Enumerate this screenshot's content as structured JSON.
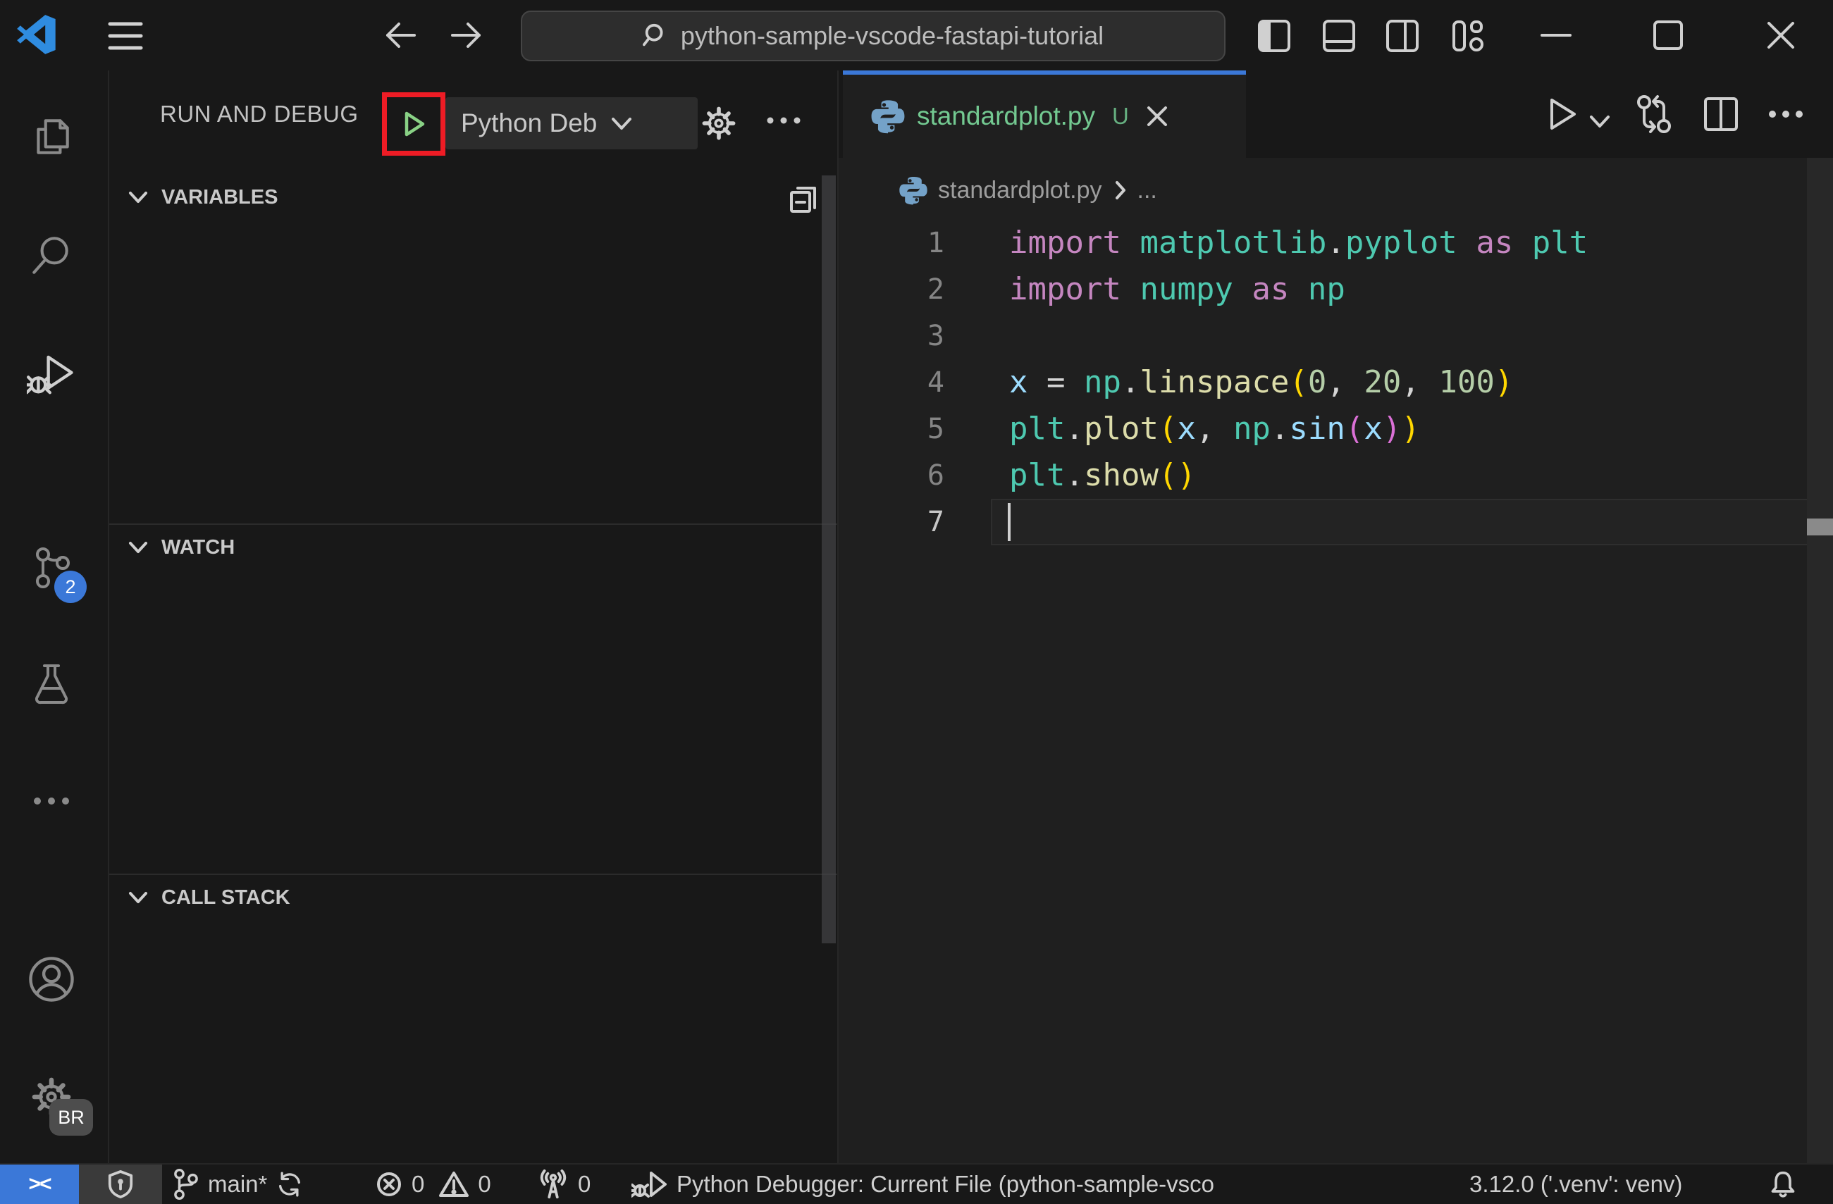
{
  "colors": {
    "accent": "#3b78d8",
    "highlight_red": "#ee1c25",
    "run_green": "#89d185",
    "untracked_green": "#73c991",
    "kw": "#C586C0",
    "mod": "#4EC9B0",
    "fn": "#DCDCAA",
    "var": "#9CDCFE",
    "num": "#B5CEA8",
    "pun": "#D4D4D4",
    "b1": "#FFD700",
    "b2": "#DA70D6",
    "gutter": "#858585"
  },
  "titlebar": {
    "search": "python-sample-vscode-fastapi-tutorial",
    "icons": [
      "vscode-logo",
      "menu-icon",
      "arrow-back-icon",
      "arrow-forward-icon",
      "search-icon",
      "layout-sidebar-icon",
      "layout-panel-icon",
      "layout-sidebar-right-icon",
      "layout-customize-icon",
      "minimize-icon",
      "maximize-icon",
      "close-icon"
    ]
  },
  "activitybar": {
    "items": [
      "explorer",
      "search",
      "run-and-debug",
      "source-control",
      "testing",
      "more",
      "account",
      "settings"
    ],
    "active_item": "run-and-debug",
    "source_control_badge": "2",
    "profile_badge": "BR"
  },
  "sidebar": {
    "title": "RUN AND DEBUG",
    "config_label": "Python Deb",
    "sections": [
      "VARIABLES",
      "WATCH",
      "CALL STACK"
    ],
    "icons": [
      "play-icon",
      "chevron-down-icon",
      "gear-icon",
      "ellipsis-icon",
      "collapse-all-icon"
    ]
  },
  "editor": {
    "tab_label": "standardplot.py",
    "tab_dirty": "U",
    "breadcrumb_file": "standardplot.py",
    "breadcrumb_more": "...",
    "toolbar_icons": [
      "run-icon",
      "chevron-down-icon",
      "compare-changes-icon",
      "split-editor-icon",
      "ellipsis-icon"
    ],
    "code_lines": [
      {
        "num": "1",
        "tokens": [
          {
            "c": "kw",
            "t": "import"
          },
          {
            "c": "pln",
            "t": " "
          },
          {
            "c": "mod",
            "t": "matplotlib"
          },
          {
            "c": "pun",
            "t": "."
          },
          {
            "c": "mod",
            "t": "pyplot"
          },
          {
            "c": "pln",
            "t": " "
          },
          {
            "c": "kw",
            "t": "as"
          },
          {
            "c": "pln",
            "t": " "
          },
          {
            "c": "mod",
            "t": "plt"
          }
        ]
      },
      {
        "num": "2",
        "tokens": [
          {
            "c": "kw",
            "t": "import"
          },
          {
            "c": "pln",
            "t": " "
          },
          {
            "c": "mod",
            "t": "numpy"
          },
          {
            "c": "pln",
            "t": " "
          },
          {
            "c": "kw",
            "t": "as"
          },
          {
            "c": "pln",
            "t": " "
          },
          {
            "c": "mod",
            "t": "np"
          }
        ]
      },
      {
        "num": "3",
        "tokens": []
      },
      {
        "num": "4",
        "tokens": [
          {
            "c": "var",
            "t": "x"
          },
          {
            "c": "pun",
            "t": " = "
          },
          {
            "c": "mod",
            "t": "np"
          },
          {
            "c": "pun",
            "t": "."
          },
          {
            "c": "fn",
            "t": "linspace"
          },
          {
            "c": "b1",
            "t": "("
          },
          {
            "c": "num",
            "t": "0"
          },
          {
            "c": "pun",
            "t": ", "
          },
          {
            "c": "num",
            "t": "20"
          },
          {
            "c": "pun",
            "t": ", "
          },
          {
            "c": "num",
            "t": "100"
          },
          {
            "c": "b1",
            "t": ")"
          }
        ]
      },
      {
        "num": "5",
        "tokens": [
          {
            "c": "mod",
            "t": "plt"
          },
          {
            "c": "pun",
            "t": "."
          },
          {
            "c": "fn",
            "t": "plot"
          },
          {
            "c": "b1",
            "t": "("
          },
          {
            "c": "var",
            "t": "x"
          },
          {
            "c": "pun",
            "t": ", "
          },
          {
            "c": "mod",
            "t": "np"
          },
          {
            "c": "pun",
            "t": "."
          },
          {
            "c": "var",
            "t": "sin"
          },
          {
            "c": "b2",
            "t": "("
          },
          {
            "c": "var",
            "t": "x"
          },
          {
            "c": "b2",
            "t": ")"
          },
          {
            "c": "b1",
            "t": ")"
          }
        ]
      },
      {
        "num": "6",
        "tokens": [
          {
            "c": "mod",
            "t": "plt"
          },
          {
            "c": "pun",
            "t": "."
          },
          {
            "c": "fn",
            "t": "show"
          },
          {
            "c": "b1",
            "t": "("
          },
          {
            "c": "b1",
            "t": ")"
          }
        ]
      },
      {
        "num": "7",
        "tokens": [],
        "cursor": true,
        "current": true
      }
    ]
  },
  "statusbar": {
    "remote": "><",
    "branch": "main*",
    "errors": "0",
    "warnings": "0",
    "ports": "0",
    "debugger_text": "Python Debugger: Current File (python-sample-vsco",
    "python_version": "3.12.0 ('.venv': venv)",
    "icons": [
      "remote-icon",
      "shield-icon",
      "git-branch-icon",
      "sync-icon",
      "error-icon",
      "warning-icon",
      "radio-tower-icon",
      "debug-icon",
      "bell-icon"
    ]
  }
}
